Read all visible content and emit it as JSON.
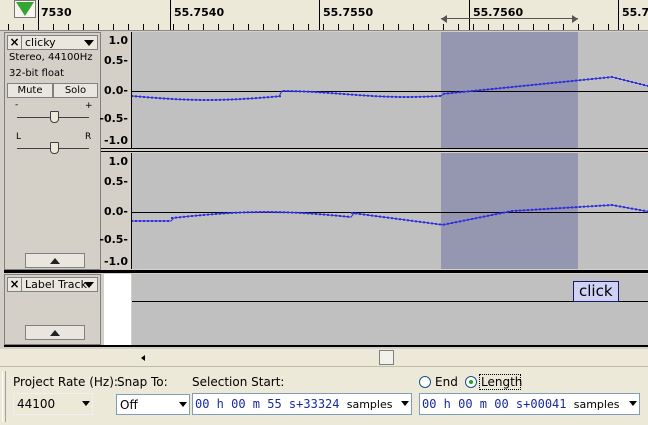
{
  "ruler": {
    "labels": [
      "7530",
      "55.7540",
      "55.7550",
      "55.7560",
      "55.75"
    ]
  },
  "audio_track": {
    "name": "clicky",
    "info_line1": "Stereo, 44100Hz",
    "info_line2": "32-bit float",
    "mute_label": "Mute",
    "solo_label": "Solo",
    "gain_minus": "-",
    "gain_plus": "+",
    "pan_left": "L",
    "pan_right": "R",
    "vruler_labels": [
      "1.0",
      "0.5-",
      "0.0-",
      "-0.5-",
      "-1.0"
    ]
  },
  "label_track": {
    "name": "Label Track",
    "labels": [
      "click"
    ]
  },
  "selection_toolbar": {
    "project_rate_label": "Project Rate (Hz):",
    "project_rate_value": "44100",
    "snap_to_label": "Snap To:",
    "snap_to_value": "Off",
    "selection_start_label": "Selection Start:",
    "selection_start_value": "00 h 00 m 55 s+33324",
    "selection_start_format": "samples",
    "end_label": "End",
    "length_label": "Length",
    "length_selected": true,
    "length_value": "00 h 00 m 00 s+00041",
    "length_format": "samples"
  },
  "colors": {
    "waveform": "#2e2ee0",
    "selection": "#9596b0",
    "background": "#c0c0c0",
    "play_head": "#33a533",
    "label_fill": "#cfd1f5"
  }
}
